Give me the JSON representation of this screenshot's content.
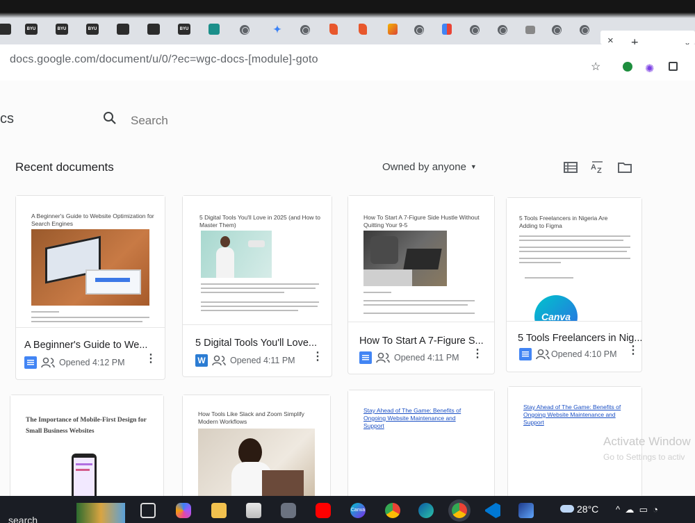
{
  "browser": {
    "url": "docs.google.com/document/u/0/?ec=wgc-docs-[module]-goto",
    "tab_labels": [
      "BYU",
      "BYU",
      "BYU",
      "BYU"
    ],
    "close_glyph": "×",
    "new_tab_glyph": "+"
  },
  "app": {
    "name": "cs",
    "search_placeholder": "Search"
  },
  "recent": {
    "heading": "Recent documents",
    "owner_filter": "Owned by anyone"
  },
  "documents": [
    {
      "title": "A Beginner's Guide to We...",
      "thumb_title": "A Beginner's Guide to Website Optimization for Search Engines",
      "meta": "Opened 4:12 PM",
      "icon": "google-docs-icon"
    },
    {
      "title": "5 Digital Tools You'll Love...",
      "thumb_title": "5 Digital Tools You'll Love in 2025 (and How to Master Them)",
      "meta": "Opened 4:11 PM",
      "icon": "word-icon"
    },
    {
      "title": "How To Start A 7-Figure S...",
      "thumb_title": "How To Start A 7-Figure Side Hustle Without Quitting Your 9-5",
      "meta": "Opened 4:11 PM",
      "icon": "google-docs-icon"
    },
    {
      "title": "5 Tools Freelancers in Nig...",
      "thumb_title": "5 Tools Freelancers in Nigeria Are Adding to Figma",
      "meta": "Opened 4:10 PM",
      "icon": "google-docs-icon",
      "thumb_logo": "Canva"
    },
    {
      "thumb_title": "The Importance of Mobile-First Design for Small Business Websites"
    },
    {
      "thumb_title": "How Tools Like Slack and Zoom Simplify Modern Workflows"
    },
    {
      "thumb_title": "Stay Ahead of The Game: Benefits of Ongoing Website Maintenance and Support"
    },
    {
      "thumb_title": "Stay Ahead of The Game: Benefits of Ongoing Website Maintenance and Support"
    }
  ],
  "watermark": {
    "title": "Activate Window",
    "subtitle": "Go to Settings to activ"
  },
  "taskbar": {
    "search_label": "search",
    "temperature": "28°C",
    "canva_label": "Canva"
  },
  "colors": {
    "docs_blue": "#4285f4",
    "word_blue": "#2b7cd3",
    "taskbar": "#1a1d24"
  }
}
